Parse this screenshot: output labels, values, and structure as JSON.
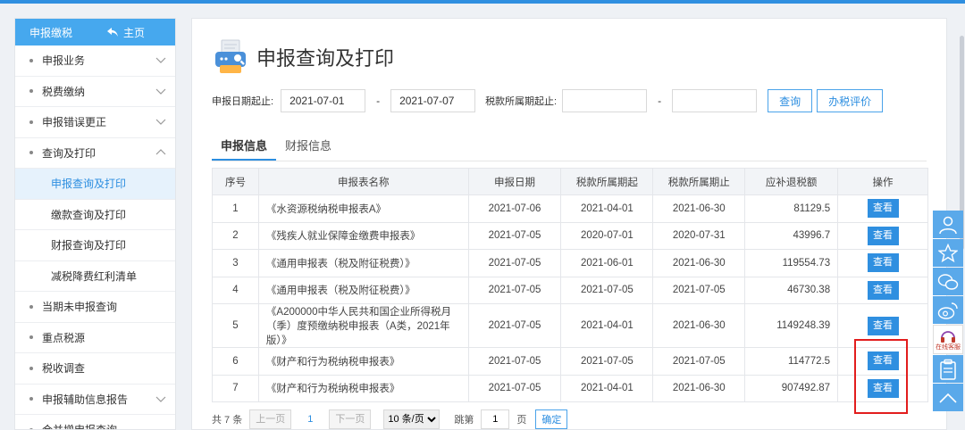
{
  "sidebar": {
    "header_title": "申报缴税",
    "home_label": "主页",
    "items": [
      {
        "label": "申报业务"
      },
      {
        "label": "税费缴纳"
      },
      {
        "label": "申报错误更正"
      },
      {
        "label": "查询及打印"
      },
      {
        "label": "申报查询及打印"
      },
      {
        "label": "缴款查询及打印"
      },
      {
        "label": "财报查询及打印"
      },
      {
        "label": "减税降费红利清单"
      },
      {
        "label": "当期未申报查询"
      },
      {
        "label": "重点税源"
      },
      {
        "label": "税收调查"
      },
      {
        "label": "申报辅助信息报告"
      },
      {
        "label": "合并增申报查询"
      }
    ]
  },
  "page": {
    "title": "申报查询及打印"
  },
  "filter": {
    "date_label": "申报日期起止:",
    "date_start": "2021-07-01",
    "dash": "-",
    "date_end": "2021-07-07",
    "period_label": "税款所属期起止:",
    "period_start": "",
    "period_end": "",
    "query_btn": "查询",
    "rate_btn": "办税评价"
  },
  "tabs": [
    {
      "label": "申报信息"
    },
    {
      "label": "财报信息"
    }
  ],
  "table": {
    "headers": [
      "序号",
      "申报表名称",
      "申报日期",
      "税款所属期起",
      "税款所属期止",
      "应补退税额",
      "操作"
    ],
    "view_label": "查看",
    "rows": [
      {
        "no": "1",
        "name": "《水资源税纳税申报表A》",
        "date": "2021-07-06",
        "start": "2021-04-01",
        "end": "2021-06-30",
        "amount": "81129.5"
      },
      {
        "no": "2",
        "name": "《残疾人就业保障金缴费申报表》",
        "date": "2021-07-05",
        "start": "2020-07-01",
        "end": "2020-07-31",
        "amount": "43996.7"
      },
      {
        "no": "3",
        "name": "《通用申报表（税及附征税费）》",
        "date": "2021-07-05",
        "start": "2021-06-01",
        "end": "2021-06-30",
        "amount": "119554.73"
      },
      {
        "no": "4",
        "name": "《通用申报表（税及附征税费）》",
        "date": "2021-07-05",
        "start": "2021-07-05",
        "end": "2021-07-05",
        "amount": "46730.38"
      },
      {
        "no": "5",
        "name": "《A200000中华人民共和国企业所得税月（季）度预缴纳税申报表（A类，2021年版）》",
        "date": "2021-07-05",
        "start": "2021-04-01",
        "end": "2021-06-30",
        "amount": "1149248.39"
      },
      {
        "no": "6",
        "name": "《财产和行为税纳税申报表》",
        "date": "2021-07-05",
        "start": "2021-07-05",
        "end": "2021-07-05",
        "amount": "114772.5"
      },
      {
        "no": "7",
        "name": "《财产和行为税纳税申报表》",
        "date": "2021-07-05",
        "start": "2021-04-01",
        "end": "2021-06-30",
        "amount": "907492.87"
      }
    ]
  },
  "pager": {
    "total": "共 7 条",
    "prev": "上一页",
    "page": "1",
    "next": "下一页",
    "page_size": "10 条/页",
    "goto_label": "跳第",
    "goto_value": "1",
    "page_unit": "页",
    "confirm": "确定"
  },
  "float_bar": {
    "service_label": "在线客服",
    "icons": [
      "user-icon",
      "star-icon",
      "wechat-icon",
      "weibo-icon",
      "headset-icon",
      "clipboard-icon",
      "arrow-up-icon"
    ]
  },
  "colors": {
    "accent": "#2f8fe0",
    "header_blue": "#46a8ee",
    "highlight": "#e21d1d"
  }
}
